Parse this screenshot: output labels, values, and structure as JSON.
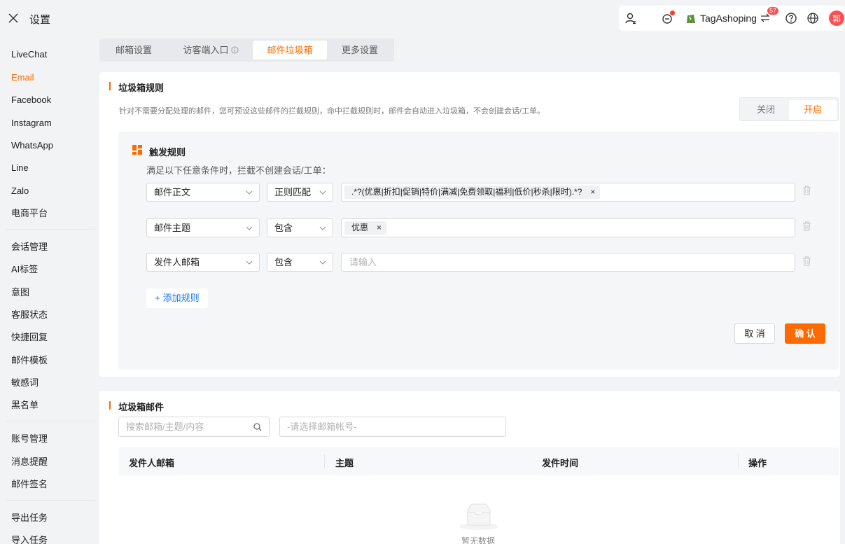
{
  "header": {
    "title": "设置"
  },
  "topbar": {
    "shop_name": "TagAshoping",
    "badge_count": "57",
    "avatar_text": "郭"
  },
  "sidebar": {
    "group1": [
      "LiveChat",
      "Email",
      "Facebook",
      "Instagram",
      "WhatsApp",
      "Line",
      "Zalo",
      "电商平台"
    ],
    "group2": [
      "会话管理",
      "AI标签",
      "意图",
      "客服状态",
      "快捷回复",
      "邮件模板",
      "敏感词",
      "黑名单"
    ],
    "group3": [
      "账号管理",
      "消息提醒",
      "邮件签名"
    ],
    "group4": [
      "导出任务",
      "导入任务"
    ]
  },
  "tabs": [
    "邮箱设置",
    "访客端入口",
    "邮件垃圾箱",
    "更多设置"
  ],
  "spam_rules": {
    "title": "垃圾箱规则",
    "description": "针对不需要分配处理的邮件，您可预设这些邮件的拦截规则，命中拦截规则时，邮件会自动进入垃圾箱，不会创建会话/工单。",
    "switch_off": "关闭",
    "switch_on": "开启",
    "trigger_title": "触发规则",
    "trigger_sub": "满足以下任意条件时，拦截不创建会话/工单：",
    "rules": [
      {
        "field": "邮件正文",
        "op": "正则匹配",
        "tag": ".*?(优惠|折扣|促销|特价|满减|免费领取|福利|低价|秒杀|限时).*?"
      },
      {
        "field": "邮件主题",
        "op": "包含",
        "tag": "优惠"
      },
      {
        "field": "发件人邮箱",
        "op": "包含",
        "placeholder": "请输入"
      }
    ],
    "add_rule": "+ 添加规则",
    "cancel": "取 消",
    "confirm": "确 认"
  },
  "spam_mail": {
    "title": "垃圾箱邮件",
    "search_placeholder": "搜索邮箱/主题/内容",
    "account_placeholder": "-请选择邮箱帐号-",
    "columns": [
      "发件人邮箱",
      "主题",
      "发件时间",
      "操作"
    ],
    "empty_text": "暂无数据"
  }
}
